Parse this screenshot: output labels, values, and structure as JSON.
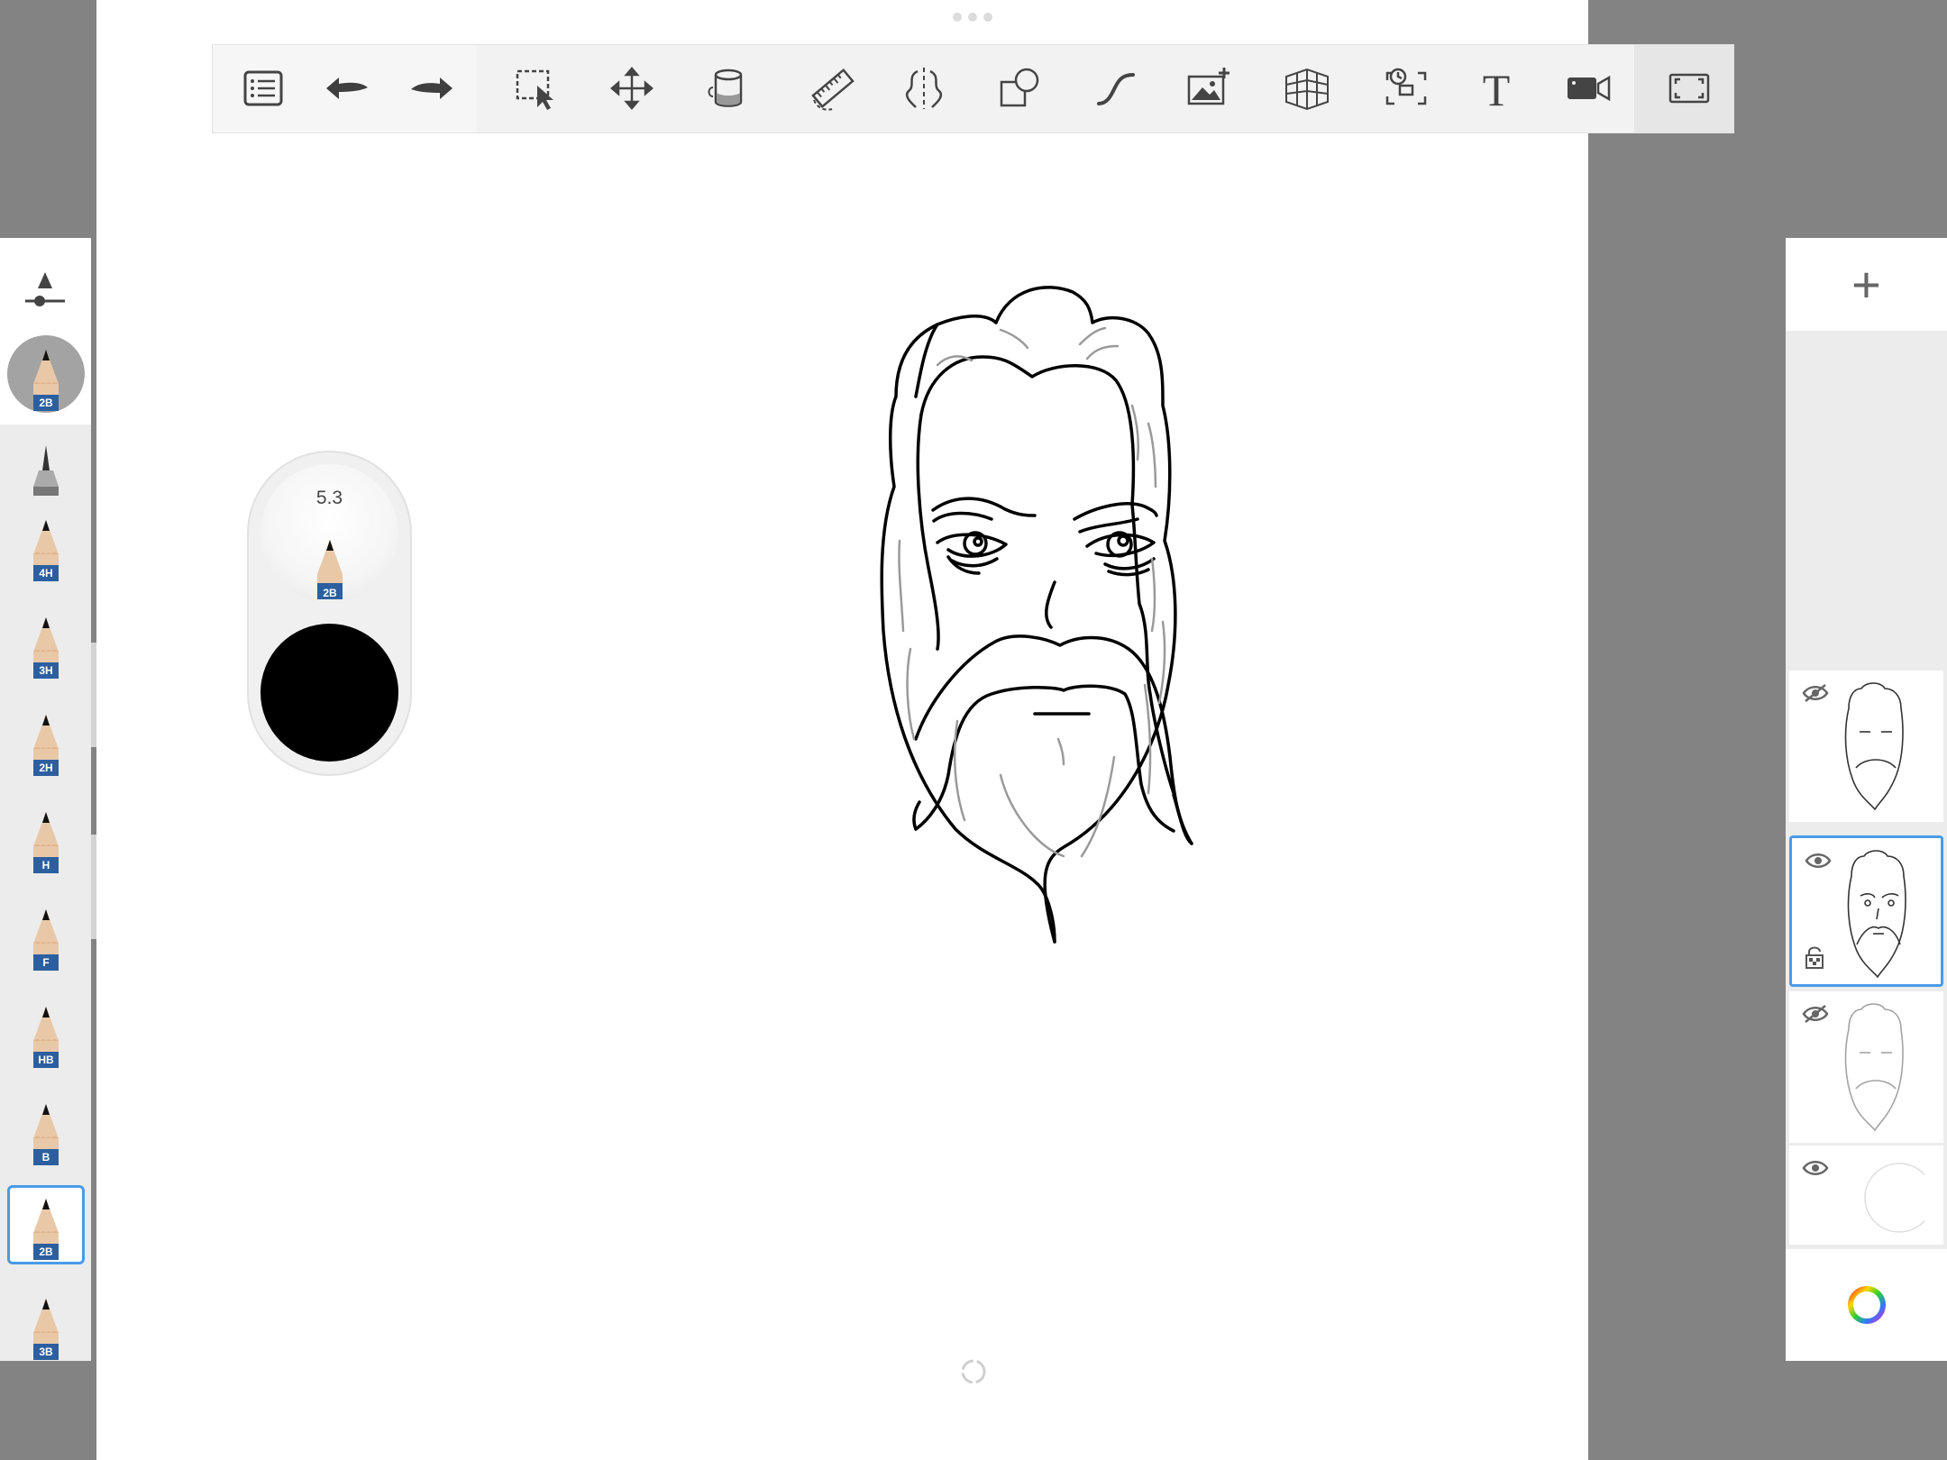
{
  "app": {
    "toolbar": {
      "tools": [
        {
          "name": "menu-list-icon"
        },
        {
          "name": "undo-icon"
        },
        {
          "name": "redo-icon"
        },
        {
          "name": "selection-icon"
        },
        {
          "name": "transform-move-icon"
        },
        {
          "name": "fill-bucket-icon"
        },
        {
          "name": "ruler-icon"
        },
        {
          "name": "symmetry-icon"
        },
        {
          "name": "shapes-icon"
        },
        {
          "name": "stroke-curve-icon"
        },
        {
          "name": "add-image-icon"
        },
        {
          "name": "perspective-grid-icon"
        },
        {
          "name": "time-lapse-icon"
        },
        {
          "name": "text-icon"
        },
        {
          "name": "record-video-icon"
        },
        {
          "name": "fullscreen-icon"
        }
      ]
    },
    "brushes": {
      "top_brush": "2B",
      "items": [
        "4H",
        "3H",
        "2H",
        "H",
        "F",
        "HB",
        "B",
        "2B",
        "3B"
      ],
      "selected": "2B"
    },
    "widget": {
      "size": "5.3",
      "brush_label": "2B",
      "color": "#000000"
    },
    "layers": {
      "add_label": "+",
      "items": [
        {
          "visible": false,
          "selected": false
        },
        {
          "visible": true,
          "selected": true
        },
        {
          "visible": false,
          "selected": false
        },
        {
          "visible": true,
          "selected": false
        }
      ]
    },
    "colors": {
      "accent": "#4a9be8",
      "pencil_band": "#2c5fa0",
      "pencil_wood": "#e9c8a8"
    }
  }
}
